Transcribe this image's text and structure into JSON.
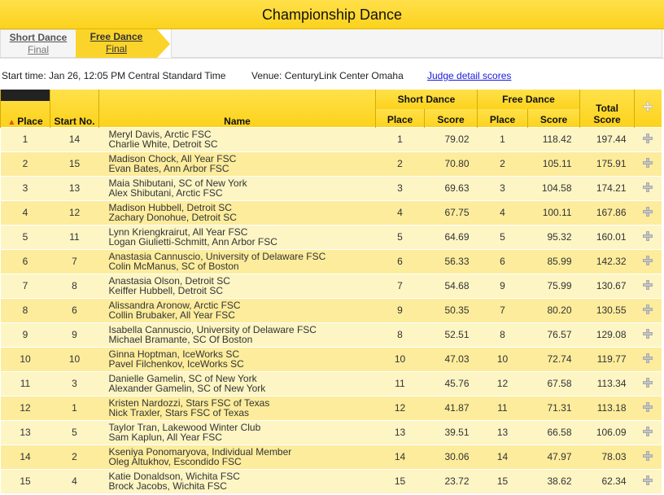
{
  "title": "Championship Dance",
  "tabs": {
    "short": {
      "line1": "Short Dance",
      "line2": "Final"
    },
    "free": {
      "line1": "Free Dance",
      "line2": "Final"
    }
  },
  "info": {
    "start": "Start time: Jan 26, 12:05 PM Central Standard Time",
    "venue": "Venue: CenturyLink Center Omaha",
    "judge_link": "Judge detail scores"
  },
  "headers": {
    "place": "Place",
    "start_no": "Start No.",
    "name": "Name",
    "short_dance": "Short Dance",
    "free_dance": "Free Dance",
    "total_line1": "Total",
    "total_line2": "Score",
    "sd_place": "Place",
    "sd_score": "Score",
    "fd_place": "Place",
    "fd_score": "Score"
  },
  "rows": [
    {
      "place": "1",
      "start": "14",
      "n1": "Meryl Davis, Arctic FSC",
      "n2": "Charlie White, Detroit SC",
      "sdp": "1",
      "sds": "79.02",
      "fdp": "1",
      "fds": "118.42",
      "total": "197.44"
    },
    {
      "place": "2",
      "start": "15",
      "n1": "Madison Chock, All Year FSC",
      "n2": "Evan Bates, Ann Arbor FSC",
      "sdp": "2",
      "sds": "70.80",
      "fdp": "2",
      "fds": "105.11",
      "total": "175.91"
    },
    {
      "place": "3",
      "start": "13",
      "n1": "Maia Shibutani, SC of New York",
      "n2": "Alex Shibutani, Arctic FSC",
      "sdp": "3",
      "sds": "69.63",
      "fdp": "3",
      "fds": "104.58",
      "total": "174.21"
    },
    {
      "place": "4",
      "start": "12",
      "n1": "Madison Hubbell, Detroit SC",
      "n2": "Zachary Donohue, Detroit SC",
      "sdp": "4",
      "sds": "67.75",
      "fdp": "4",
      "fds": "100.11",
      "total": "167.86"
    },
    {
      "place": "5",
      "start": "11",
      "n1": "Lynn Kriengkrairut, All Year FSC",
      "n2": "Logan Giulietti-Schmitt, Ann Arbor FSC",
      "sdp": "5",
      "sds": "64.69",
      "fdp": "5",
      "fds": "95.32",
      "total": "160.01"
    },
    {
      "place": "6",
      "start": "7",
      "n1": "Anastasia Cannuscio, University of Delaware FSC",
      "n2": "Colin McManus, SC of Boston",
      "sdp": "6",
      "sds": "56.33",
      "fdp": "6",
      "fds": "85.99",
      "total": "142.32"
    },
    {
      "place": "7",
      "start": "8",
      "n1": "Anastasia Olson, Detroit SC",
      "n2": "Keiffer Hubbell, Detroit SC",
      "sdp": "7",
      "sds": "54.68",
      "fdp": "9",
      "fds": "75.99",
      "total": "130.67"
    },
    {
      "place": "8",
      "start": "6",
      "n1": "Alissandra Aronow, Arctic FSC",
      "n2": "Collin Brubaker, All Year FSC",
      "sdp": "9",
      "sds": "50.35",
      "fdp": "7",
      "fds": "80.20",
      "total": "130.55"
    },
    {
      "place": "9",
      "start": "9",
      "n1": "Isabella Cannuscio, University of Delaware FSC",
      "n2": "Michael Bramante, SC Of Boston",
      "sdp": "8",
      "sds": "52.51",
      "fdp": "8",
      "fds": "76.57",
      "total": "129.08"
    },
    {
      "place": "10",
      "start": "10",
      "n1": "Ginna Hoptman, IceWorks SC",
      "n2": "Pavel Filchenkov, IceWorks SC",
      "sdp": "10",
      "sds": "47.03",
      "fdp": "10",
      "fds": "72.74",
      "total": "119.77"
    },
    {
      "place": "11",
      "start": "3",
      "n1": "Danielle Gamelin, SC of New York",
      "n2": "Alexander Gamelin, SC of New York",
      "sdp": "11",
      "sds": "45.76",
      "fdp": "12",
      "fds": "67.58",
      "total": "113.34"
    },
    {
      "place": "12",
      "start": "1",
      "n1": "Kristen Nardozzi, Stars FSC of Texas",
      "n2": "Nick Traxler, Stars FSC of Texas",
      "sdp": "12",
      "sds": "41.87",
      "fdp": "11",
      "fds": "71.31",
      "total": "113.18"
    },
    {
      "place": "13",
      "start": "5",
      "n1": "Taylor Tran, Lakewood Winter Club",
      "n2": "Sam Kaplun, All Year FSC",
      "sdp": "13",
      "sds": "39.51",
      "fdp": "13",
      "fds": "66.58",
      "total": "106.09"
    },
    {
      "place": "14",
      "start": "2",
      "n1": "Kseniya Ponomaryova, Individual Member",
      "n2": "Oleg Altukhov, Escondido FSC",
      "sdp": "14",
      "sds": "30.06",
      "fdp": "14",
      "fds": "47.97",
      "total": "78.03"
    },
    {
      "place": "15",
      "start": "4",
      "n1": "Katie Donaldson, Wichita FSC",
      "n2": "Brock Jacobs, Wichita FSC",
      "sdp": "15",
      "sds": "23.72",
      "fdp": "15",
      "fds": "38.62",
      "total": "62.34"
    }
  ]
}
